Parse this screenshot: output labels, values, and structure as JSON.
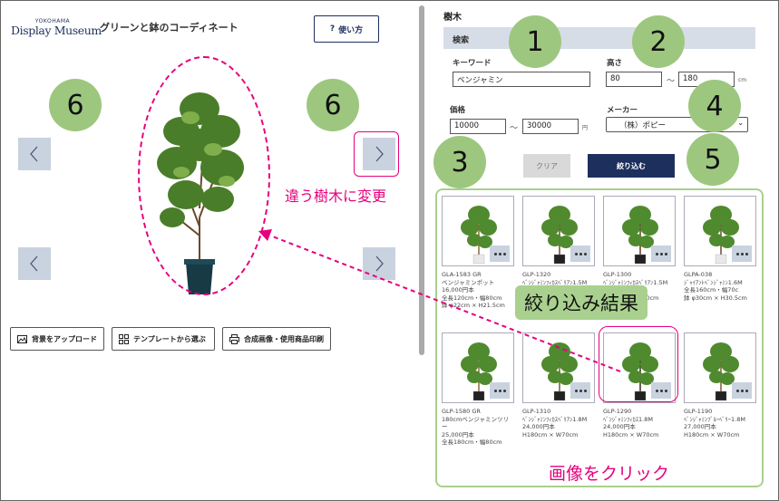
{
  "app": {
    "logo_top": "YOKOHAMA",
    "logo_main": "Display Museum",
    "title": "グリーンと鉢のコーディネート",
    "help_label": "使い方"
  },
  "toolbar": {
    "upload": "背景をアップロード",
    "template": "テンプレートから選ぶ",
    "print": "合成画像・使用商品印刷"
  },
  "annotations": {
    "n1": "1",
    "n2": "2",
    "n3": "3",
    "n4": "4",
    "n5": "5",
    "n6": "6",
    "change_text": "違う樹木に変更",
    "result_text": "絞り込み結果",
    "click_text": "画像をクリック"
  },
  "search": {
    "section": "樹木",
    "bar": "検索",
    "keyword_label": "キーワード",
    "keyword_value": "ベンジャミン",
    "height_label": "高さ",
    "height_min": "80",
    "height_max": "180",
    "height_unit": "cm",
    "price_label": "価格",
    "price_min": "10000",
    "price_max": "30000",
    "price_unit": "円",
    "maker_label": "メーカー",
    "maker_value": "（株）ポピー",
    "tilde": "～",
    "clear_label": "クリア",
    "apply_label": "絞り込む"
  },
  "products": [
    {
      "l1": "GLA-1583 GR",
      "l2": "ベンジャミンポット",
      "l3": "16,000円本",
      "l4": "全長120cm・幅80cm",
      "l5": "鉢 φ22cm × H21.5cm"
    },
    {
      "l1": "GLP-1320",
      "l2": "ﾍﾞﾝｼﾞｬﾐﾝﾌｨｶｽﾍﾞﾘｱﾝ1.5M",
      "l3": "16,000円本",
      "l4": "H150cm × W70cm",
      "l5": ""
    },
    {
      "l1": "GLP-1300",
      "l2": "ﾍﾞﾝｼﾞｬﾐﾝﾌｨｶｽﾍﾞﾘｱﾝ1.5M",
      "l3": "16,000円本",
      "l4": "H150cm × W70cm",
      "l5": ""
    },
    {
      "l1": "GLPA-038",
      "l2": "ｼﾞｬｲｱﾝﾄﾍﾞﾝｼﾞｬﾐﾝ1.6M",
      "l3": "",
      "l4": "全長160cm・幅70c",
      "l5": "鉢 φ30cm × H30.5cm"
    },
    {
      "l1": "GLP-1580 GR",
      "l2": "180cmベンジャミンツリ",
      "l3": "ー",
      "l4": "25,000円本",
      "l5": "全長180cm・幅80cm"
    },
    {
      "l1": "GLP-1310",
      "l2": "ﾍﾞﾝｼﾞｬﾐﾝﾌｨｶｽﾍﾞﾘｱﾝ1.8M",
      "l3": "24,000円本",
      "l4": "H180cm × W70cm",
      "l5": ""
    },
    {
      "l1": "GLP-1290",
      "l2": "ﾍﾞﾝｼﾞｬﾐﾝﾌｨｶｽ1.8M",
      "l3": "24,000円本",
      "l4": "H180cm × W70cm",
      "l5": ""
    },
    {
      "l1": "GLP-1190",
      "l2": "ﾍﾞﾝｼﾞｬﾐﾝﾌﾞﾙｰﾍﾞﾘｰ1.8M",
      "l3": "27,000円本",
      "l4": "H180cm × W70cm",
      "l5": ""
    }
  ],
  "colors": {
    "accent": "#1d2f5c",
    "annotation": "#e6007e",
    "highlight": "#a9d08e",
    "circle": "#9dc77f",
    "button_bg": "#c9d2df"
  },
  "icons": [
    "help-icon",
    "chevron-left-icon",
    "chevron-right-icon",
    "image-icon",
    "grid-icon",
    "printer-icon",
    "more-icon"
  ]
}
